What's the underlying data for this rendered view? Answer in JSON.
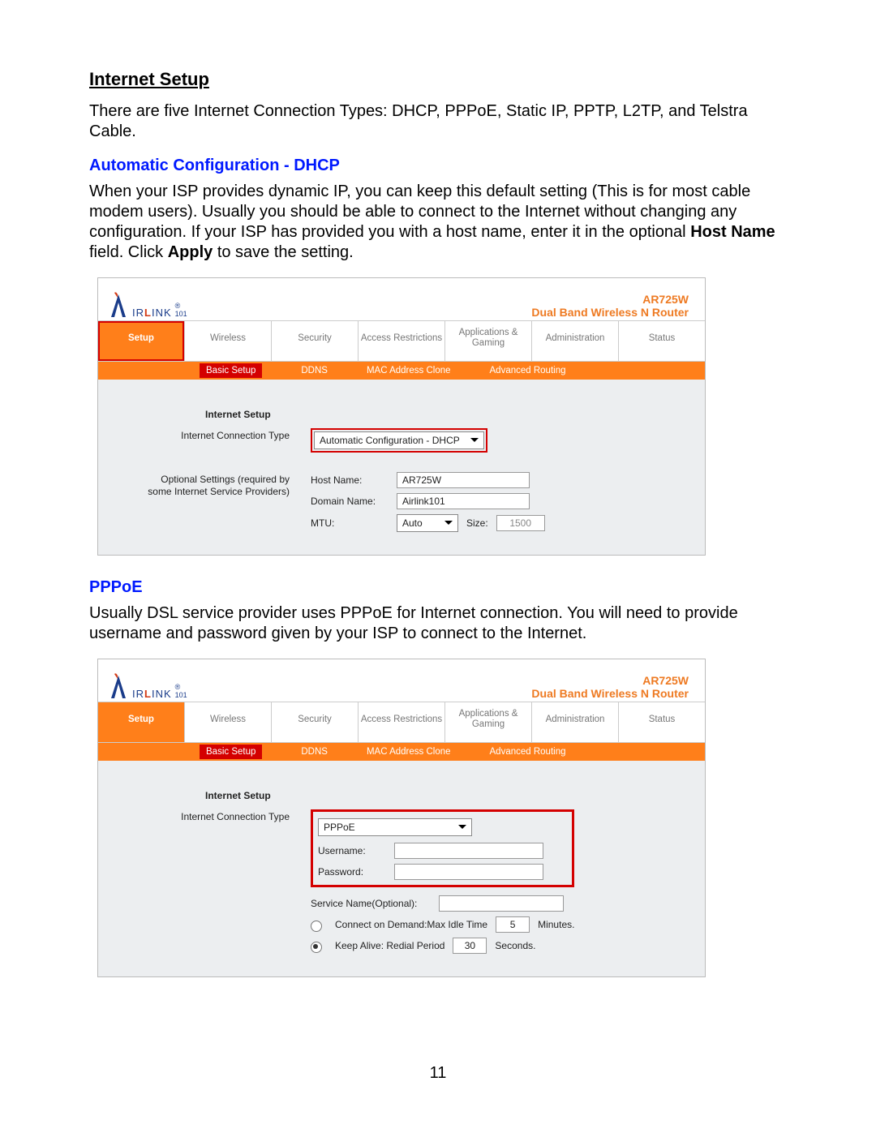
{
  "page_number": "11",
  "section": {
    "title": "Internet Setup",
    "intro": "There are five Internet Connection Types: DHCP, PPPoE, Static IP, PPTP, L2TP, and Telstra Cable."
  },
  "dhcp": {
    "heading": "Automatic Configuration - DHCP",
    "text_pre": "When your ISP provides dynamic IP, you can keep this default setting (This is for most cable modem users). Usually you should be able to connect to the Internet without changing any configuration. If your ISP has provided you with a host name, enter it in the optional ",
    "bold1": "Host Name",
    "text_mid": " field. Click ",
    "bold2": "Apply",
    "text_post": " to save the setting."
  },
  "pppoe": {
    "heading": "PPPoE",
    "text": "Usually DSL service provider uses PPPoE for Internet connection. You will need to provide username and password given by your ISP to connect to the Internet."
  },
  "router": {
    "logo_text1": "IR",
    "logo_text2": "L",
    "logo_text3": "INK",
    "logo_reg": "®",
    "logo_sub": "101",
    "model": "AR725W",
    "tagline": "Dual Band Wireless N Router",
    "tabs": [
      "Setup",
      "Wireless",
      "Security",
      "Access Restrictions",
      "Applications & Gaming",
      "Administration",
      "Status"
    ],
    "subtabs": [
      "Basic Setup",
      "DDNS",
      "MAC Address Clone",
      "Advanced Routing"
    ]
  },
  "shot1": {
    "section": "Internet Setup",
    "ict_label": "Internet Connection Type",
    "ict_value": "Automatic Configuration - DHCP",
    "opt_label": "Optional Settings (required by some Internet Service Providers)",
    "hostname_label": "Host Name:",
    "hostname_value": "AR725W",
    "domain_label": "Domain Name:",
    "domain_value": "Airlink101",
    "mtu_label": "MTU:",
    "mtu_select": "Auto",
    "size_label": "Size:",
    "size_value": "1500"
  },
  "shot2": {
    "section": "Internet Setup",
    "ict_label": "Internet Connection Type",
    "ict_value": "PPPoE",
    "username_label": "Username:",
    "username_value": "",
    "password_label": "Password:",
    "password_value": "",
    "service_label": "Service Name(Optional):",
    "service_value": "",
    "cod_label": "Connect on Demand:Max Idle Time",
    "cod_value": "5",
    "cod_unit": "Minutes.",
    "ka_label": "Keep Alive: Redial Period",
    "ka_value": "30",
    "ka_unit": "Seconds."
  }
}
